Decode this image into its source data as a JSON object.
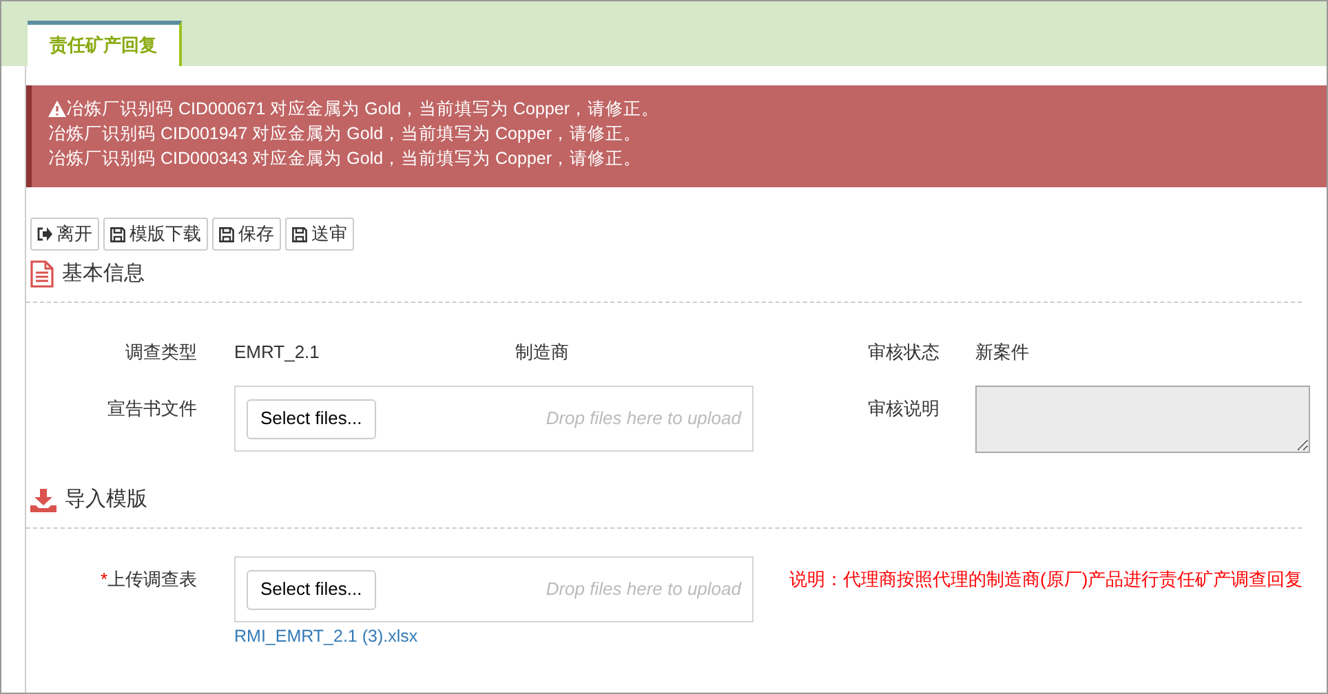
{
  "tabs": [
    {
      "label": "责任矿产回复",
      "selected": true
    }
  ],
  "alert": {
    "messages": [
      "冶炼厂识别码 CID000671 对应金属为 Gold，当前填写为 Copper，请修正。",
      "冶炼厂识别码 CID001947 对应金属为 Gold，当前填写为 Copper，请修正。",
      "冶炼厂识别码 CID000343 对应金属为 Gold，当前填写为 Copper，请修正。"
    ]
  },
  "toolbar": [
    {
      "label": "离开",
      "kind": "exit"
    },
    {
      "label": "模版下载",
      "kind": "save"
    },
    {
      "label": "保存",
      "kind": "save"
    },
    {
      "label": "送审",
      "kind": "save"
    }
  ],
  "basic_info": {
    "title": "基本信息",
    "survey_type": {
      "label": "调查类型",
      "value": "EMRT_2.1"
    },
    "manufacturer": {
      "label": "制造商"
    },
    "review_status": {
      "label": "审核状态",
      "value": "新案件"
    },
    "declaration": {
      "label": "宣告书文件",
      "button": "Select files...",
      "placeholder": "Drop files here to upload"
    },
    "review_note": {
      "label": "审核说明",
      "disabled": true
    }
  },
  "import": {
    "title": "导入模版",
    "upload": {
      "required_mark": "*",
      "label": "上传调查表",
      "button": "Select files...",
      "placeholder": "Drop files here to upload",
      "files": [
        "RMI_EMRT_2.1 (3).xlsx"
      ]
    },
    "note": "说明：代理商按照代理的制造商(原厂)产品进行责任矿产调查回复"
  }
}
